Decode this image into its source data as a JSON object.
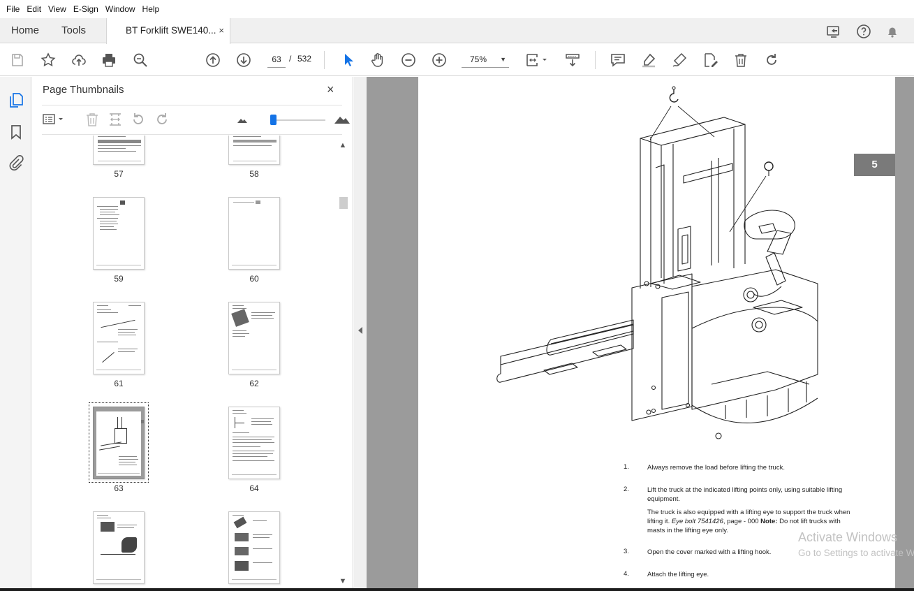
{
  "menu": [
    "File",
    "Edit",
    "View",
    "E-Sign",
    "Window",
    "Help"
  ],
  "tabs": {
    "home": "Home",
    "tools": "Tools",
    "document": "BT Forklift SWE140...",
    "close": "×"
  },
  "toolbar": {
    "current_page": "63",
    "separator": "/",
    "total_pages": "532",
    "zoom": "75%"
  },
  "thumbnail_panel": {
    "title": "Page Thumbnails",
    "close": "×",
    "thumbs": [
      {
        "label": "57"
      },
      {
        "label": "58"
      },
      {
        "label": "59"
      },
      {
        "label": "60"
      },
      {
        "label": "61"
      },
      {
        "label": "62"
      },
      {
        "label": "63"
      },
      {
        "label": "64"
      },
      {
        "label": ""
      },
      {
        "label": ""
      }
    ],
    "selected_page": "63"
  },
  "document": {
    "chapter_tab": "5",
    "steps": [
      {
        "num": "1.",
        "text": "Always remove the load before lifting the truck."
      },
      {
        "num": "2.",
        "text": "Lift the truck at the indicated lifting points only, using suitable lifting equipment."
      },
      {
        "num": "",
        "text_a": "The truck is also equipped with a lifting eye to support the truck when lifting it. ",
        "text_b": "Eye bolt 7541426",
        "text_c": ", page  - 000 ",
        "text_d": "Note:",
        "text_e": " Do not lift trucks with masts in the lifting eye only."
      },
      {
        "num": "3.",
        "text": "Open the cover marked with a lifting hook."
      },
      {
        "num": "4.",
        "text": "Attach the lifting eye."
      }
    ]
  },
  "watermark": {
    "line1": "Activate Windows",
    "line2": "Go to Settings to activate Windows."
  },
  "colors": {
    "accent": "#1473e6",
    "chapter_tab": "#7a7a7a",
    "doc_background": "#9b9b9b"
  }
}
